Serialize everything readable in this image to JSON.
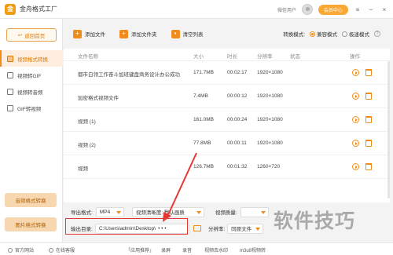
{
  "app": {
    "title": "金舟格式工厂",
    "user_label": "微信用户",
    "vip_label": "会员中心"
  },
  "sidebar": {
    "back_label": "返回首页",
    "items": [
      {
        "label": "视频格式转换",
        "active": true
      },
      {
        "label": "视频转GIF",
        "active": false
      },
      {
        "label": "视频转音频",
        "active": false
      },
      {
        "label": "GIF转视频",
        "active": false
      }
    ],
    "btn_audio": "音频格式转换",
    "btn_image": "图片格式转换"
  },
  "toolbar": {
    "add_file": "添加文件",
    "add_folder": "添加文件夹",
    "clear_list": "清空列表",
    "mode_label": "转换模式:",
    "mode_compat": "兼容模式",
    "mode_fast": "极速模式"
  },
  "table": {
    "headers": {
      "name": "文件名称",
      "size": "大小",
      "duration": "时长",
      "resolution": "分辨率",
      "status": "状态",
      "action": "操作"
    },
    "rows": [
      {
        "name": "都市白领工作奋斗加班键盘商务设计办公成功",
        "size": "171.7MB",
        "duration": "00:02:17",
        "resolution": "1920×1080"
      },
      {
        "name": "加密格式视频文件",
        "size": "7.4MB",
        "duration": "00:00:12",
        "resolution": "1920×1080"
      },
      {
        "name": "视频 (1)",
        "size": "161.0MB",
        "duration": "00:00:24",
        "resolution": "1920×1080"
      },
      {
        "name": "视频 (2)",
        "size": "77.8MB",
        "duration": "00:00:11",
        "resolution": "1920×1080"
      },
      {
        "name": "视频",
        "size": "126.7MB",
        "duration": "00:01:32",
        "resolution": "1260×720"
      }
    ]
  },
  "settings": {
    "format_label": "导出格式:",
    "format_value": "MP4",
    "quality_value": "视频清晰度: 默认画质",
    "video_quality_label": "视频质量:",
    "outdir_label": "输出目录:",
    "outdir_value": "C:\\Users\\admin\\Desktop\\",
    "outdir_more": "• • •",
    "resolution_label": "分辨率:",
    "resolution_value": "同原文件"
  },
  "statusbar": {
    "website": "官方网站",
    "support": "在线客服",
    "recommend": "「应用推荐」",
    "record": "录屏",
    "audio": "录音",
    "watermark": "视频去水印",
    "m3u8": "m3u8视频转"
  },
  "watermark_text": "软件技巧",
  "colors": {
    "accent": "#f08c1c",
    "highlight": "#e53935"
  }
}
